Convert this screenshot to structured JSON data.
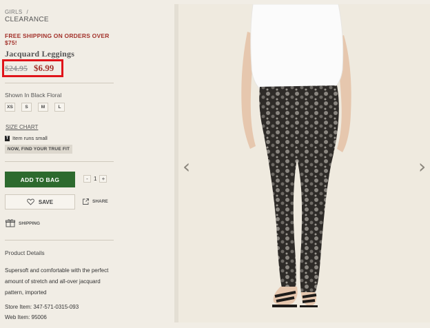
{
  "breadcrumb": {
    "parent": "GIRLS",
    "separator": "/",
    "current": "CLEARANCE"
  },
  "promo": "FREE SHIPPING ON ORDERS OVER $75!",
  "product": {
    "name": "Jacquard Leggings",
    "old_price": "$24.95",
    "new_price": "$6.99",
    "shown_in": "Shown In Black Floral",
    "sizes": [
      "XS",
      "S",
      "M",
      "L"
    ],
    "size_chart": "SIZE CHART",
    "runs_small": "Item runs small",
    "fit_button": "NOW, FIND YOUR TRUE FIT",
    "add_to_bag": "ADD TO BAG",
    "quantity": {
      "minus": "-",
      "value": "1",
      "plus": "+"
    },
    "save": "SAVE",
    "share": "SHARE",
    "shipping": "SHIPPING",
    "details_title": "Product Details",
    "details_text": "Supersoft and comfortable with the perfect amount of stretch and all-over jacquard pattern, imported",
    "store_item": "Store Item: 347-571-0315-093",
    "web_item": "Web Item: 95006"
  },
  "gallery": {
    "prev": "‹",
    "next": "›"
  },
  "colors": {
    "accent_red": "#a3322b",
    "highlight_box": "#e0141a",
    "add_bag_green": "#2d6a2e",
    "background": "#f1ede5"
  }
}
